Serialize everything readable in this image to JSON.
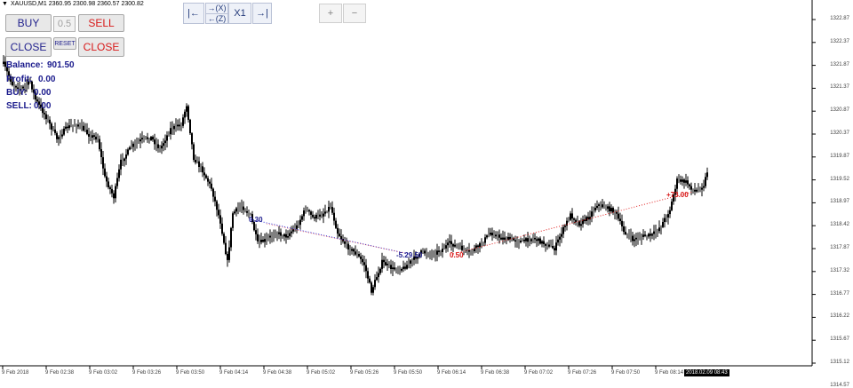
{
  "header": {
    "title": "XAUUSD,M1  2360.95 2300.98 2360.57 2300.82"
  },
  "trade_panel": {
    "buy_label": "BUY",
    "sell_label": "SELL",
    "lot_value": "0.5",
    "close_buy_label": "CLOSE",
    "reset_label": "RESET",
    "close_sell_label": "CLOSE"
  },
  "nav": {
    "first_label": "|←",
    "next_label": "→(X)",
    "prev_label": "←(Z)",
    "x1_label": "X1",
    "last_label": "→|",
    "zoom_in_label": "+",
    "zoom_out_label": "−"
  },
  "account": {
    "balance_label": "Balance:",
    "balance_value": "901.50",
    "profit_label": "Profit:",
    "profit_value": "0.00",
    "buy_label": "BUY:",
    "buy_value": "0.00",
    "sell_label": "SELL:",
    "sell_value": "0.00"
  },
  "chart_data": {
    "type": "bar",
    "price_axis": [
      "1322.87",
      "1322.37",
      "1321.87",
      "1321.37",
      "1320.87",
      "1320.37",
      "1319.87",
      "1319.52",
      "1318.97",
      "1318.42",
      "1317.87",
      "1317.32",
      "1316.77",
      "1316.22",
      "1315.67",
      "1315.12",
      "1314.57"
    ],
    "time_axis": [
      "9 Feb 2018",
      "9 Feb 02:38",
      "9 Feb 03:02",
      "9 Feb 03:26",
      "9 Feb 03:50",
      "9 Feb 04:14",
      "9 Feb 04:38",
      "9 Feb 05:02",
      "9 Feb 05:26",
      "9 Feb 05:50",
      "9 Feb 06:14",
      "9 Feb 06:38",
      "9 Feb 07:02",
      "9 Feb 07:26",
      "9 Feb 07:50",
      "9 Feb 08:14"
    ],
    "current_time": "2018.02.09 08:43",
    "trade_labels": [
      {
        "text": "0.30",
        "color": "#1a1a8c"
      },
      {
        "text": "-5.29.50",
        "color": "#1a1a8c"
      },
      {
        "text": "0.50",
        "color": "#d81818"
      },
      {
        "text": "+73.00",
        "color": "#d81818"
      }
    ],
    "colors": {
      "bar": "#000000",
      "trade_blue": "#2a2ad8",
      "trade_red": "#e02020",
      "grid": "#e0e0e0"
    }
  }
}
